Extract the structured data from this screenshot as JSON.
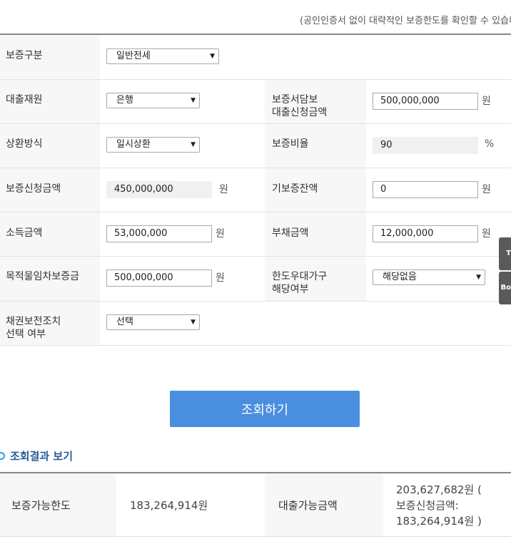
{
  "notice": "(공인인증서 없이 대략적인 보증한도를 확인할 수 있습니",
  "form": {
    "guarantee_type": {
      "label": "보증구분",
      "value": "일반전세"
    },
    "loan_source": {
      "label": "대출재원",
      "value": "은행"
    },
    "secured_loan_amount": {
      "label_1": "보증서담보",
      "label_2": "대출신청금액",
      "value": "500,000,000",
      "unit": "원"
    },
    "repayment": {
      "label": "상환방식",
      "value": "일시상환"
    },
    "guarantee_ratio": {
      "label": "보증비율",
      "value": "90",
      "unit": "%"
    },
    "guarantee_amount": {
      "label": "보증신청금액",
      "value": "450,000,000",
      "unit": "원"
    },
    "existing_guarantee": {
      "label": "기보증잔액",
      "value": "0",
      "unit": "원"
    },
    "income": {
      "label": "소득금액",
      "value": "53,000,000",
      "unit": "원"
    },
    "debt": {
      "label": "부채금액",
      "value": "12,000,000",
      "unit": "원"
    },
    "lease_deposit": {
      "label": "목적물임차보증금",
      "value": "500,000,000",
      "unit": "원"
    },
    "limit_preference": {
      "label_1": "한도우대가구",
      "label_2": "해당여부",
      "value": "해당없음"
    },
    "bond_protection": {
      "label_1": "채권보전조치",
      "label_2": "선택 여부",
      "value": "선택"
    }
  },
  "side_buttons": [
    "T",
    "Bo"
  ],
  "search_button": "조회하기",
  "results": {
    "title": "조회결과 보기",
    "limit_label": "보증가능한도",
    "limit_value": "183,264,914원",
    "loan_label": "대출가능금액",
    "loan_value_1": "203,627,682원 (",
    "loan_value_2": "보증신청금액:",
    "loan_value_3": "183,264,914원 )"
  }
}
